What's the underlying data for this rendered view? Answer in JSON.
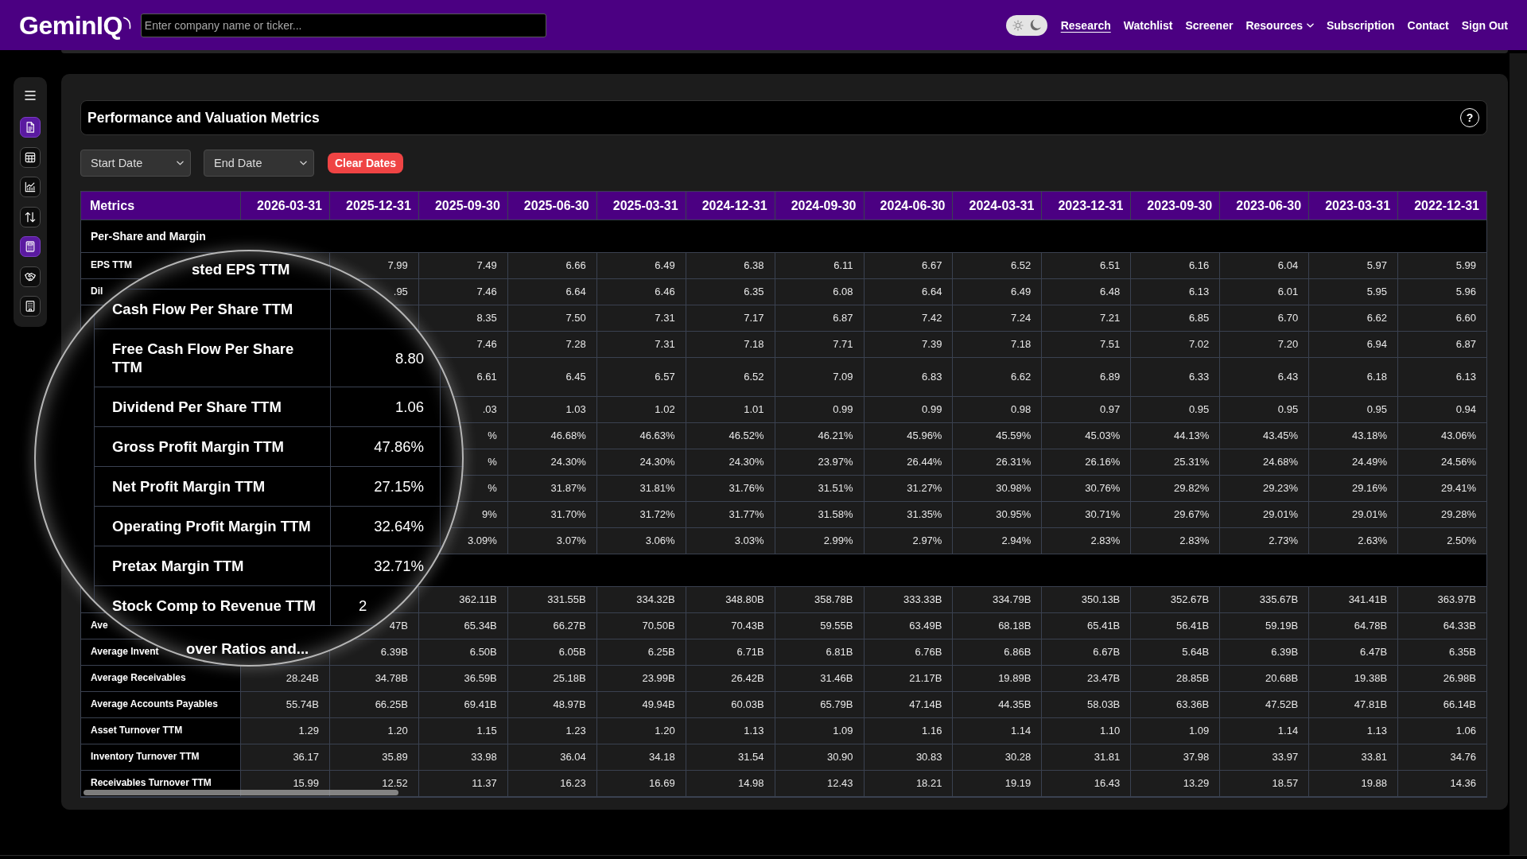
{
  "header": {
    "logo": "GeminIQ",
    "search": {
      "placeholder": "Enter company name or ticker..."
    },
    "theme_toggle": {
      "dark": true
    },
    "nav": [
      {
        "label": "Research",
        "selected": true,
        "dropdown": false
      },
      {
        "label": "Watchlist",
        "selected": false,
        "dropdown": false
      },
      {
        "label": "Screener",
        "selected": false,
        "dropdown": false
      },
      {
        "label": "Resources",
        "selected": false,
        "dropdown": true
      },
      {
        "label": "Subscription",
        "selected": false,
        "dropdown": false
      },
      {
        "label": "Contact",
        "selected": false,
        "dropdown": false
      },
      {
        "label": "Sign Out",
        "selected": false,
        "dropdown": false
      }
    ]
  },
  "sidebar": {
    "items": [
      {
        "selected": true
      },
      {
        "selected": false
      },
      {
        "selected": false
      },
      {
        "selected": false
      },
      {
        "selected": true
      },
      {
        "selected": false
      },
      {
        "selected": false
      }
    ]
  },
  "panel": {
    "title": "Performance and Valuation Metrics",
    "help": "?",
    "filters": [
      {
        "kind": "select",
        "placeholder": "Start Date"
      },
      {
        "kind": "select",
        "placeholder": "End Date"
      },
      {
        "kind": "button",
        "label": "Clear Dates"
      }
    ]
  },
  "table": {
    "columns": [
      "Metrics",
      "2026-03-31",
      "2025-12-31",
      "2025-09-30",
      "2025-06-30",
      "2025-03-31",
      "2024-12-31",
      "2024-09-30",
      "2024-06-30",
      "2024-03-31",
      "2023-12-31",
      "2023-09-30",
      "2023-06-30",
      "2023-03-31",
      "2022-12-31"
    ],
    "rows": [
      {
        "kind": "section",
        "label": "Per-Share and Margin"
      },
      {
        "kind": "data",
        "label": "EPS TTM",
        "cells": [
          "7.99",
          "7.49",
          "6.66",
          "6.49",
          "6.38",
          "6.11",
          "6.67",
          "6.52",
          "6.51",
          "6.16",
          "6.04",
          "5.97",
          "5.99"
        ]
      },
      {
        "kind": "data",
        "label": "Dil",
        "cells": [
          ".95",
          "7.46",
          "6.64",
          "6.46",
          "6.35",
          "6.08",
          "6.64",
          "6.49",
          "6.48",
          "6.13",
          "6.01",
          "5.95",
          "5.96"
        ]
      },
      {
        "kind": "data",
        "cells": [
          "8.35",
          "7.50",
          "7.31",
          "7.17",
          "6.87",
          "7.42",
          "7.24",
          "7.21",
          "6.85",
          "6.70",
          "6.62",
          "6.60"
        ]
      },
      {
        "kind": "data",
        "cells": [
          "7.46",
          "7.28",
          "7.31",
          "7.18",
          "7.71",
          "7.39",
          "7.18",
          "7.51",
          "7.02",
          "7.20",
          "6.94",
          "6.87"
        ]
      },
      {
        "kind": "double",
        "cells": [
          "6.61",
          "6.45",
          "6.57",
          "6.52",
          "7.09",
          "6.83",
          "6.62",
          "6.89",
          "6.33",
          "6.43",
          "6.18",
          "6.13"
        ]
      },
      {
        "kind": "data",
        "cells": [
          ".03",
          "1.03",
          "1.02",
          "1.01",
          "0.99",
          "0.99",
          "0.98",
          "0.97",
          "0.95",
          "0.95",
          "0.95",
          "0.94"
        ]
      },
      {
        "kind": "data",
        "cells": [
          "%",
          "46.68%",
          "46.63%",
          "46.52%",
          "46.21%",
          "45.96%",
          "45.59%",
          "45.03%",
          "44.13%",
          "43.45%",
          "43.18%",
          "43.06%"
        ]
      },
      {
        "kind": "data",
        "cells": [
          "%",
          "24.30%",
          "24.30%",
          "24.30%",
          "23.97%",
          "26.44%",
          "26.31%",
          "26.16%",
          "25.31%",
          "24.68%",
          "24.49%",
          "24.56%"
        ]
      },
      {
        "kind": "data",
        "cells": [
          "%",
          "31.87%",
          "31.81%",
          "31.76%",
          "31.51%",
          "31.27%",
          "30.98%",
          "30.76%",
          "29.82%",
          "29.23%",
          "29.16%",
          "29.41%"
        ]
      },
      {
        "kind": "data",
        "cells": [
          "9%",
          "31.70%",
          "31.72%",
          "31.77%",
          "31.58%",
          "31.35%",
          "30.95%",
          "30.71%",
          "29.67%",
          "29.01%",
          "29.01%",
          "29.28%"
        ]
      },
      {
        "kind": "data",
        "cells": [
          "3.09%",
          "3.07%",
          "3.06%",
          "3.03%",
          "2.99%",
          "2.97%",
          "2.94%",
          "2.83%",
          "2.83%",
          "2.73%",
          "2.63%",
          "2.50%"
        ]
      },
      {
        "kind": "section"
      },
      {
        "kind": "data",
        "cells": [
          "362.11B",
          "331.55B",
          "334.32B",
          "348.80B",
          "358.78B",
          "333.33B",
          "334.79B",
          "350.13B",
          "352.67B",
          "335.67B",
          "341.41B",
          "363.97B"
        ]
      },
      {
        "kind": "data",
        "label": "Ave",
        "cells": [
          "47B",
          "65.34B",
          "66.27B",
          "70.50B",
          "70.43B",
          "59.55B",
          "63.49B",
          "68.18B",
          "65.41B",
          "56.41B",
          "59.19B",
          "64.78B",
          "64.33B"
        ]
      },
      {
        "kind": "data",
        "label": "Average Invent",
        "cells": [
          "6.39B",
          "6.50B",
          "6.05B",
          "6.25B",
          "6.71B",
          "6.81B",
          "6.76B",
          "6.86B",
          "6.67B",
          "5.64B",
          "6.39B",
          "6.47B",
          "6.35B"
        ]
      },
      {
        "kind": "data",
        "label": "Average Receivables",
        "cells": [
          "28.24B",
          "34.78B",
          "36.59B",
          "25.18B",
          "23.99B",
          "26.42B",
          "31.46B",
          "21.17B",
          "19.89B",
          "23.47B",
          "28.85B",
          "20.68B",
          "19.38B",
          "26.98B"
        ]
      },
      {
        "kind": "data",
        "label": "Average Accounts Payables",
        "cells": [
          "55.74B",
          "66.25B",
          "69.41B",
          "48.97B",
          "49.94B",
          "60.03B",
          "65.79B",
          "47.14B",
          "44.35B",
          "58.03B",
          "63.36B",
          "47.52B",
          "47.81B",
          "66.14B"
        ]
      },
      {
        "kind": "data",
        "label": "Asset Turnover TTM",
        "cells": [
          "1.29",
          "1.20",
          "1.15",
          "1.23",
          "1.20",
          "1.13",
          "1.09",
          "1.16",
          "1.14",
          "1.10",
          "1.09",
          "1.14",
          "1.13",
          "1.06"
        ]
      },
      {
        "kind": "data",
        "label": "Inventory Turnover TTM",
        "cells": [
          "36.17",
          "35.89",
          "33.98",
          "36.04",
          "34.18",
          "31.54",
          "30.90",
          "30.83",
          "30.28",
          "31.81",
          "37.98",
          "33.97",
          "33.81",
          "34.76"
        ]
      },
      {
        "kind": "data",
        "label": "Receivables Turnover TTM",
        "cells": [
          "15.99",
          "12.52",
          "11.37",
          "16.23",
          "16.69",
          "14.98",
          "12.43",
          "18.21",
          "19.19",
          "16.43",
          "13.29",
          "18.57",
          "19.88",
          "14.36"
        ]
      }
    ]
  },
  "magnifier": {
    "rows": [
      {
        "kind": "cut",
        "label": "sted EPS TTM"
      },
      {
        "kind": "row",
        "label": "Cash Flow Per Share TTM"
      },
      {
        "kind": "row",
        "label": "Free Cash Flow Per Share TTM",
        "value": "8.80"
      },
      {
        "kind": "row",
        "label": "Dividend Per Share TTM",
        "value": "1.06"
      },
      {
        "kind": "row",
        "label": "Gross Profit Margin TTM",
        "value": "47.86%"
      },
      {
        "kind": "row",
        "label": "Net Profit Margin TTM",
        "value": "27.15%"
      },
      {
        "kind": "row",
        "label": "Operating Profit Margin TTM",
        "value": "32.64%"
      },
      {
        "kind": "row",
        "label": "Pretax Margin TTM",
        "value": "32.71%"
      },
      {
        "kind": "tail",
        "label": "Stock Comp to Revenue TTM",
        "value": "2"
      },
      {
        "kind": "section",
        "label": "over Ratios and..."
      }
    ]
  }
}
